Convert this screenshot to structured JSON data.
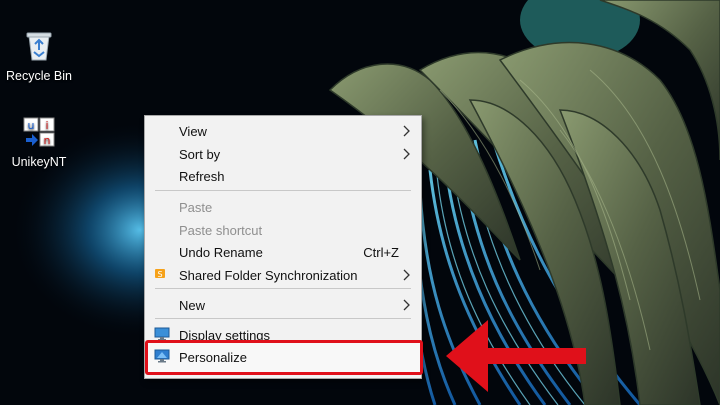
{
  "desktop": {
    "icons": [
      {
        "name": "recycle-bin",
        "label": "Recycle Bin",
        "icon": "recycle-bin-icon"
      },
      {
        "name": "unikeynt",
        "label": "UnikeyNT",
        "icon": "unikey-icon"
      }
    ]
  },
  "context_menu": {
    "items": [
      {
        "label": "View",
        "submenu": true
      },
      {
        "label": "Sort by",
        "submenu": true
      },
      {
        "label": "Refresh"
      },
      {
        "label": "Paste",
        "disabled": true
      },
      {
        "label": "Paste shortcut",
        "disabled": true
      },
      {
        "label": "Undo Rename",
        "shortcut": "Ctrl+Z"
      },
      {
        "label": "Shared Folder Synchronization",
        "submenu": true,
        "icon": "sync-icon"
      },
      {
        "label": "New",
        "submenu": true
      },
      {
        "label": "Display settings",
        "icon": "display-icon"
      },
      {
        "label": "Personalize",
        "icon": "personalize-icon",
        "highlighted": true
      }
    ]
  },
  "annotation": {
    "color": "#e0101a",
    "icon": "arrow-left-icon"
  }
}
